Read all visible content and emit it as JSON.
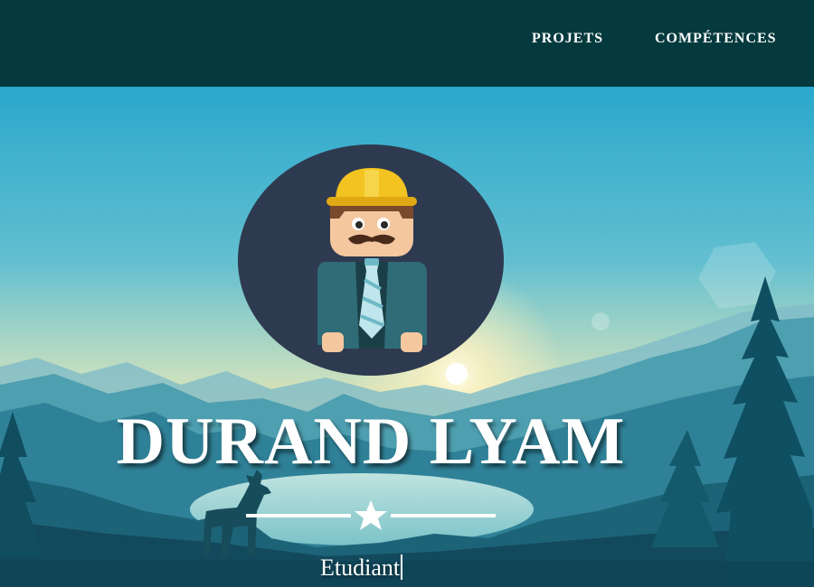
{
  "nav": {
    "items": [
      {
        "label": "PROJETS"
      },
      {
        "label": "COMPÉTENCES"
      }
    ]
  },
  "hero": {
    "name": "DURAND LYAM",
    "subtitle": "Etudiant",
    "avatar_icon": "engineer-avatar-icon",
    "divider_icon": "star-icon"
  },
  "colors": {
    "navbar": "#043a3e",
    "text": "#ffffff",
    "avatar_circle": "#2e3a4f",
    "helmet": "#f2c321"
  }
}
